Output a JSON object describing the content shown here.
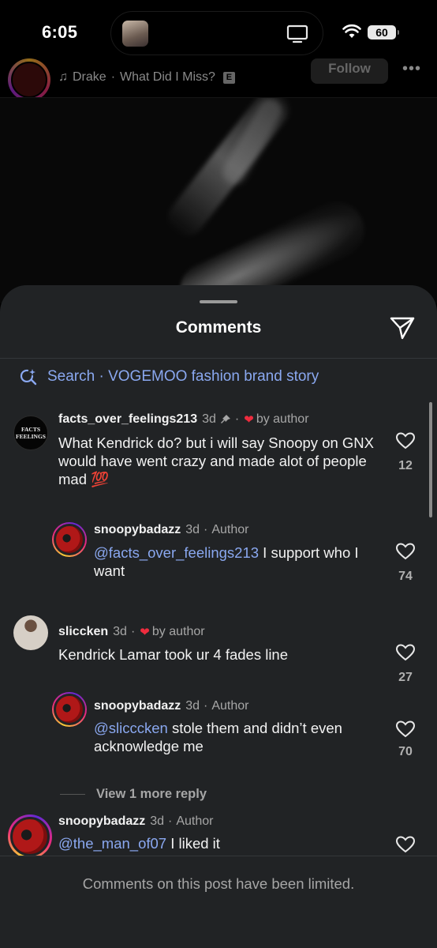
{
  "status_bar": {
    "time": "6:05",
    "battery": "60"
  },
  "post": {
    "music_artist": "Drake",
    "music_sep": "·",
    "music_track": "What Did I Miss?",
    "explicit_badge": "E",
    "follow_label": "Follow",
    "more_label": "•••"
  },
  "sheet": {
    "title": "Comments",
    "search_text": "Search · VOGEMOO fashion brand story",
    "footer": "Comments on this post have been limited."
  },
  "comments": [
    {
      "username": "facts_over_feelings213",
      "time": "3d",
      "pinned": true,
      "liked_by_author": "by author",
      "text": "What Kendrick do? but i will say Snoopy on GNX would have  went crazy and made alot of people mad 💯",
      "likes": "12",
      "avatar_text": "FACTS\nFEELINGS"
    },
    {
      "username": "snoopybadazz",
      "time": "3d",
      "author_badge": "Author",
      "mention": "@facts_over_feelings213",
      "text": " I support who I want",
      "likes": "74"
    },
    {
      "username": "sliccken",
      "time": "3d",
      "liked_by_author": "by author",
      "text": "Kendrick Lamar took ur 4 fades line",
      "likes": "27"
    },
    {
      "username": "snoopybadazz",
      "time": "3d",
      "author_badge": "Author",
      "mention": "@slicccken",
      "text": " stole them and didn’t even acknowledge me",
      "likes": "70"
    },
    {
      "username": "snoopybadazz",
      "time": "3d",
      "author_badge": "Author",
      "mention": "@the_man_of07",
      "text": " I liked it"
    }
  ],
  "view_more_replies": "View 1 more reply",
  "separator": "·",
  "colors": {
    "accent_link": "#8aa8f0",
    "heart_red": "#ee2c3e",
    "sheet_bg": "#212325"
  }
}
